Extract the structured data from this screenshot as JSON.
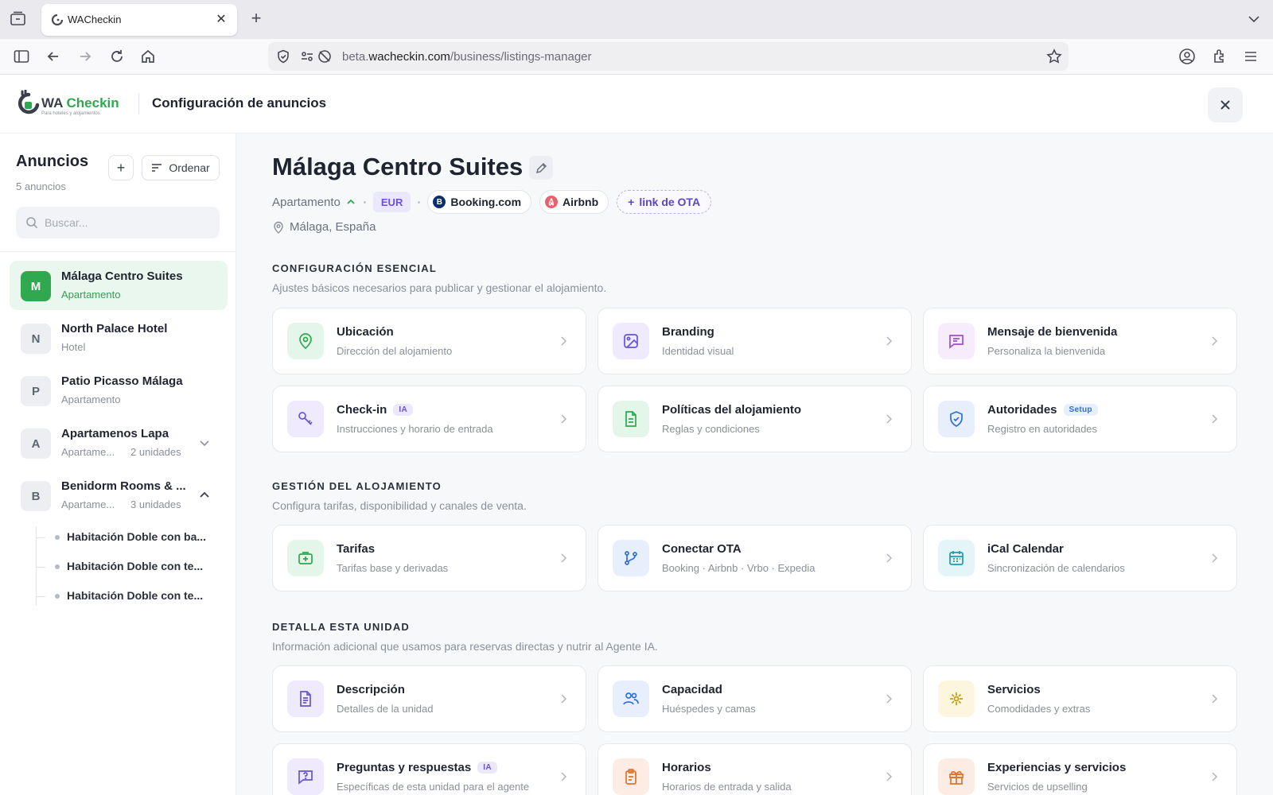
{
  "browser": {
    "tab_title": "WACheckin",
    "url_prefix": "beta.",
    "url_domain": "wacheckin.com",
    "url_path": "/business/listings-manager"
  },
  "header": {
    "logo_wa": "WA",
    "logo_checkin": "Checkin",
    "logo_tagline": "Para hoteles y alojamientos",
    "title": "Configuración de anuncios"
  },
  "sidebar": {
    "title": "Anuncios",
    "count": "5 anuncios",
    "sort_label": "Ordenar",
    "search_placeholder": "Buscar...",
    "listings": [
      {
        "initial": "M",
        "name": "Málaga Centro Suites",
        "type": "Apartamento",
        "units": "",
        "active": true
      },
      {
        "initial": "N",
        "name": "North Palace Hotel",
        "type": "Hotel",
        "units": ""
      },
      {
        "initial": "P",
        "name": "Patio Picasso Málaga",
        "type": "Apartamento",
        "units": ""
      },
      {
        "initial": "A",
        "name": "Apartamenos Lapa",
        "type": "Apartame...",
        "units": "2 unidades",
        "expanded": false
      },
      {
        "initial": "B",
        "name": "Benidorm Rooms & ...",
        "type": "Apartame...",
        "units": "3 unidades",
        "expanded": true
      }
    ],
    "sub_units": [
      "Habitación Doble con ba...",
      "Habitación Doble con te...",
      "Habitación Doble con te..."
    ]
  },
  "main": {
    "title": "Málaga Centro Suites",
    "type": "Apartamento",
    "currency": "EUR",
    "ota_links": [
      {
        "label": "Booking.com",
        "glyph": "B",
        "color": "#0b2f6b"
      },
      {
        "label": "Airbnb",
        "glyph": "a",
        "color": "#e8616d"
      }
    ],
    "add_ota_label": "link de OTA",
    "location": "Málaga, España",
    "sections": [
      {
        "title": "CONFIGURACIÓN ESENCIAL",
        "subtitle": "Ajustes básicos necesarios para publicar y gestionar el alojamiento.",
        "cards": [
          {
            "title": "Ubicación",
            "subtitle": "Dirección del alojamiento",
            "icon": "map-pin-icon",
            "badge": ""
          },
          {
            "title": "Branding",
            "subtitle": "Identidad visual",
            "icon": "image-icon",
            "badge": ""
          },
          {
            "title": "Mensaje de bienvenida",
            "subtitle": "Personaliza la bienvenida",
            "icon": "message-icon",
            "badge": ""
          },
          {
            "title": "Check-in",
            "subtitle": "Instrucciones y horario de entrada",
            "icon": "key-icon",
            "badge": "IA"
          },
          {
            "title": "Políticas del alojamiento",
            "subtitle": "Reglas y condiciones",
            "icon": "document-icon",
            "badge": ""
          },
          {
            "title": "Autoridades",
            "subtitle": "Registro en autoridades",
            "icon": "shield-check-icon",
            "badge": "Setup"
          }
        ]
      },
      {
        "title": "GESTIÓN DEL ALOJAMIENTO",
        "subtitle": "Configura tarifas, disponibilidad y canales de venta.",
        "cards": [
          {
            "title": "Tarifas",
            "subtitle": "Tarifas base y derivadas",
            "icon": "briefcase-icon",
            "badge": ""
          },
          {
            "title": "Conectar OTA",
            "subtitle": "Booking · Airbnb · Vrbo · Expedia",
            "icon": "git-branch-icon",
            "badge": ""
          },
          {
            "title": "iCal Calendar",
            "subtitle": "Sincronización de calendarios",
            "icon": "calendar-icon",
            "badge": ""
          }
        ]
      },
      {
        "title": "DETALLA ESTA UNIDAD",
        "subtitle": "Información adicional que usamos para reservas directas y nutrir al Agente IA.",
        "cards": [
          {
            "title": "Descripción",
            "subtitle": "Detalles de la unidad",
            "icon": "file-text-icon",
            "badge": ""
          },
          {
            "title": "Capacidad",
            "subtitle": "Huéspedes y camas",
            "icon": "users-icon",
            "badge": ""
          },
          {
            "title": "Servicios",
            "subtitle": "Comodidades y extras",
            "icon": "sparkle-icon",
            "badge": ""
          },
          {
            "title": "Preguntas y respuestas",
            "subtitle": "Específicas de esta unidad para el agente",
            "icon": "question-message-icon",
            "badge": "IA"
          },
          {
            "title": "Horarios",
            "subtitle": "Horarios de entrada y salida",
            "icon": "clipboard-icon",
            "badge": ""
          },
          {
            "title": "Experiencias y servicios",
            "subtitle": "Servicios de upselling",
            "icon": "gift-icon",
            "badge": ""
          }
        ]
      }
    ]
  },
  "colors": {
    "brand_green": "#2fa84f",
    "accent_purple": "#6b52d6",
    "setup_blue": "#2f6fd6"
  }
}
